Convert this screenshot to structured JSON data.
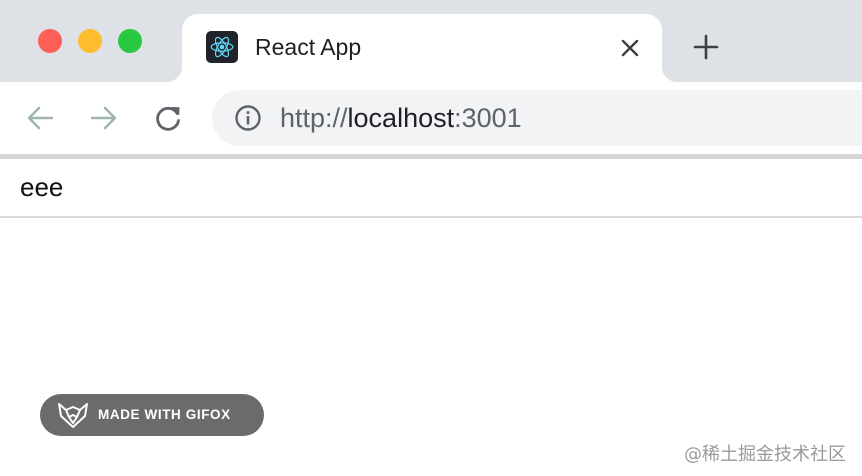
{
  "window_controls": {
    "close_color": "#fe5f57",
    "minimize_color": "#febc2e",
    "zoom_color": "#28c840"
  },
  "tab": {
    "title": "React App",
    "favicon": "react-logo-icon",
    "close_icon": "close-icon"
  },
  "new_tab_icon": "plus-icon",
  "toolbar": {
    "back_icon": "arrow-left-icon",
    "forward_icon": "arrow-right-icon",
    "reload_icon": "reload-icon"
  },
  "address_bar": {
    "info_icon": "info-icon",
    "url_scheme": "http://",
    "url_host": "localhost",
    "url_port": ":3001"
  },
  "page": {
    "text": "eee"
  },
  "badge": {
    "logo": "gifox-fox-icon",
    "label": "MADE WITH GIFOX"
  },
  "watermark": "@稀土掘金技术社区"
}
